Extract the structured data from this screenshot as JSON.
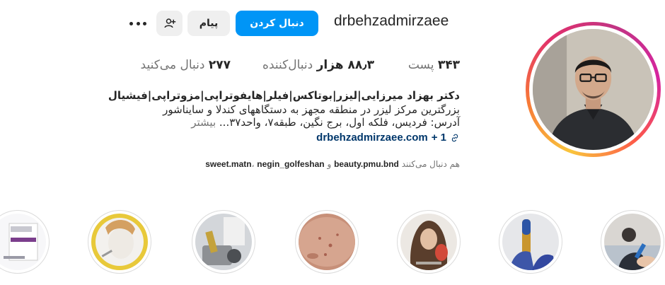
{
  "profile": {
    "username": "drbehzadmirzaee",
    "follow_label": "دنبال کردن",
    "message_label": "پیام",
    "stats": {
      "posts_value": "۳۴۳",
      "posts_label": "پست",
      "followers_value": "۸۸٫۳ هزار",
      "followers_label": "دنبال‌کننده",
      "following_value": "۲۷۷",
      "following_label": "دنبال می‌کنید"
    },
    "bio": {
      "name": "دکتر بهزاد میرزایی|لیزر|بوتاکس|فیلر|هایفوتراپی|مزوتراپی|فیشیال",
      "line1": "بزرگترین مرکز لیزر در منطقه مجهز به دستگاههای کندلا و سایناشور",
      "line2": "آدرس: فردیس، فلکه اول، برج نگین، طبقه۷، واحد۳۷...",
      "more_label": "بیشتر",
      "link_text": "drbehzadmirzaee.com",
      "link_extra": "+ 1"
    },
    "followed_by": {
      "prefix": "هم دنبال می‌کنند",
      "user1": "beauty.pmu.bnd",
      "sep1": "و",
      "user2": "sweet.matn",
      "sep2": "،",
      "user3": "negin_golfeshan"
    }
  },
  "icons": {
    "more": "more-horizontal-icon",
    "suggest": "person-add-icon",
    "link": "link-icon"
  },
  "colors": {
    "primary_button": "#0095f6",
    "secondary_button": "#efefef",
    "link": "#00376b",
    "muted": "#737373"
  }
}
